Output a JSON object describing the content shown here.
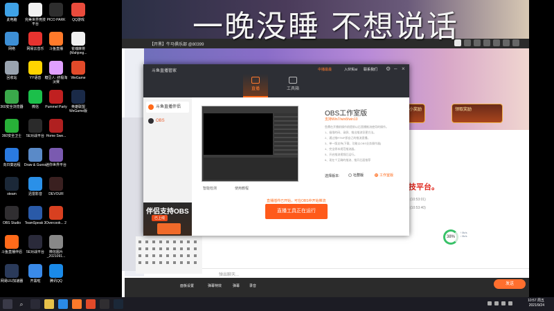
{
  "overlay_title": "一晚没睡 不想说话",
  "desktop_icons": [
    {
      "label": "此电脑",
      "color": "#3fa2e6"
    },
    {
      "label": "完美世界竞技平台",
      "color": "#f2f2f2"
    },
    {
      "label": "PICO PARK",
      "color": "#2e2e2e"
    },
    {
      "label": "QQ游戏",
      "color": "#e94b3c"
    },
    {
      "label": "网络",
      "color": "#3d8fd6"
    },
    {
      "label": "网易云音乐",
      "color": "#e8332f"
    },
    {
      "label": "斗鱼直播",
      "color": "#ff7a2a"
    },
    {
      "label": "雀魂麻将(Mahjong...",
      "color": "#f0f0f0"
    },
    {
      "label": "回收站",
      "color": "#9aa4b0"
    },
    {
      "label": "YY语音",
      "color": "#ffd400"
    },
    {
      "label": "糖豆人: 终极淘汰赛",
      "color": "#e0a0ff"
    },
    {
      "label": "WeGame",
      "color": "#e24a2a"
    },
    {
      "label": "360安全浏览器",
      "color": "#3aa84a"
    },
    {
      "label": "微信",
      "color": "#1bbf4a"
    },
    {
      "label": "Pummel Party",
      "color": "#c02020"
    },
    {
      "label": "英雄联盟WeGame版",
      "color": "#1a2a48"
    },
    {
      "label": "360安全卫士",
      "color": "#28b038"
    },
    {
      "label": "5E对战平台",
      "color": "#2a2a2a"
    },
    {
      "label": "Home Swe...",
      "color": "#b02020"
    },
    {
      "label": "",
      "color": "#000000"
    },
    {
      "label": "向日葵远程",
      "color": "#2a7ae0"
    },
    {
      "label": "Draw & Guess",
      "color": "#5a8ac8"
    },
    {
      "label": "迷你世界平台",
      "color": "#7a5ab0"
    },
    {
      "label": "",
      "color": "#000000"
    },
    {
      "label": "steam",
      "color": "#1b2838"
    },
    {
      "label": "迅雷影音",
      "color": "#2a90e8"
    },
    {
      "label": "DEVOUR",
      "color": "#3a2020"
    },
    {
      "label": "",
      "color": "#000000"
    },
    {
      "label": "OBS Studio",
      "color": "#302e31"
    },
    {
      "label": "TeamSpeak 3",
      "color": "#2a5aa8"
    },
    {
      "label": "Overcook... 2",
      "color": "#d84020"
    },
    {
      "label": "",
      "color": "#000000"
    },
    {
      "label": "斗鱼直播伴侣",
      "color": "#ff6a1a"
    },
    {
      "label": "5E对战平台",
      "color": "#2a2a3a"
    },
    {
      "label": "微信图片_2021091...",
      "color": "#888888"
    },
    {
      "label": "",
      "color": "#000000"
    },
    {
      "label": "网易UU加速器",
      "color": "#2a3a5a"
    },
    {
      "label": "开黑啦",
      "color": "#3a8ae8"
    },
    {
      "label": "腾讯QQ",
      "color": "#1a8ae8"
    },
    {
      "label": "",
      "color": "#000000"
    }
  ],
  "stream_page": {
    "tab_title": "【开黑】牛马俱乐部 @80399",
    "red_banner_text": "技平台。",
    "timestamps": [
      "(10:53:01)",
      "(10:53:40)"
    ],
    "progress_percent": "38%",
    "net_speed": [
      "↑ 0k/s",
      "↓ 0k/s"
    ],
    "chat_placeholder": "弹出聊天...",
    "send_label": "发送",
    "banner_buttons": [
      "小奖励",
      "领取奖励",
      "LV6",
      "领取奖励"
    ],
    "bottom_items": [
      "面板设置",
      "弹幕特效",
      "弹幕",
      "录音"
    ]
  },
  "dialog": {
    "title": "斗鱼直播管家",
    "head_links": [
      "中播最最",
      "入伙实ai",
      "联系我们"
    ],
    "tabs": [
      {
        "label": "直播",
        "active": true
      },
      {
        "label": "工具箱",
        "active": false
      }
    ],
    "side_items": [
      {
        "label": "斗鱼直播伴侣",
        "color": "#ff6a1a",
        "active": true
      },
      {
        "label": "OBS",
        "color": "#302e31",
        "active": false
      }
    ],
    "promo_title": "伴侣支持OBS",
    "promo_badge": "已上线",
    "preview_captions": [
      "智能检测",
      "使用教程"
    ],
    "obs_title": "OBS工作室版",
    "obs_subtitle": "支持Win7/win8/win10",
    "obs_lines": [
      "鱼鹰在开播前操作前提前以后直播推流使用的操作。",
      "1、极限的码、录屏、推出推流导更方法。",
      "2、通过推RTMP即自己的推流直播。",
      "3、单一版支持(下载、功能以OBS业务操作器)",
      "4、完全原本规范推流器。",
      "5、开启推流视频后运行。",
      "6、现在个正确的推流、推开后面推荐"
    ],
    "version_label": "选择版本:",
    "radio_options": [
      {
        "label": "社群版",
        "selected": false
      },
      {
        "label": "工作室版",
        "selected": true
      }
    ],
    "tip": "直播插件已开始，可在OBS中开始推流",
    "start_button": "直播工具正在运行"
  },
  "taskbar": {
    "time": "10:57 周五",
    "date": "2021/9/24"
  }
}
